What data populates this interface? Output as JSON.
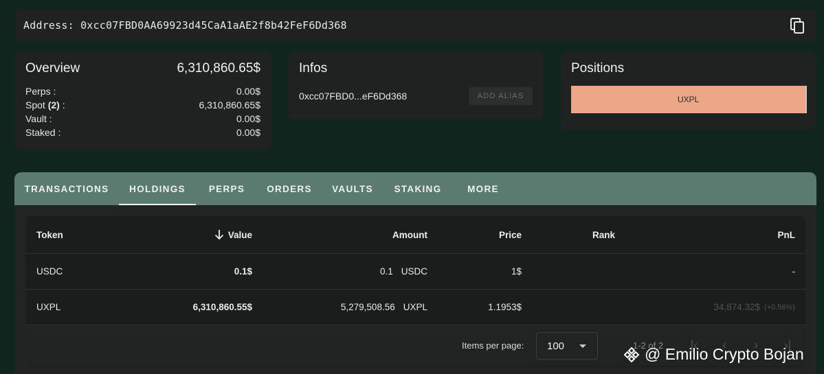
{
  "address_bar": {
    "label": "Address: 0xcc07FBD0AA69923d45CaA1aAE2f8b42FeF6Dd368"
  },
  "overview": {
    "title": "Overview",
    "total": "6,310,860.65$",
    "rows": [
      {
        "label": "Perps :",
        "value": "0.00$"
      },
      {
        "label_pre": "Spot ",
        "label_bold": "(2)",
        "label_post": " :",
        "value": "6,310,860.65$"
      },
      {
        "label": "Vault :",
        "value": "0.00$"
      },
      {
        "label": "Staked :",
        "value": "0.00$"
      }
    ]
  },
  "infos": {
    "title": "Infos",
    "short_address": "0xcc07FBD0...eF6Dd368",
    "add_alias_label": "ADD ALIAS"
  },
  "positions": {
    "title": "Positions",
    "items": [
      {
        "label": "UXPL",
        "color": "#eea688"
      }
    ]
  },
  "tabs": [
    "TRANSACTIONS",
    "HOLDINGS",
    "PERPS",
    "ORDERS",
    "VAULTS",
    "STAKING",
    "MORE"
  ],
  "active_tab": "HOLDINGS",
  "table": {
    "headers": {
      "token": "Token",
      "value": "Value",
      "amount": "Amount",
      "price": "Price",
      "rank": "Rank",
      "pnl": "PnL"
    },
    "sort_icon": "arrow-down-icon",
    "rows": [
      {
        "token": "USDC",
        "value": "0.1$",
        "amount": "0.1",
        "amount_unit": "USDC",
        "price": "1$",
        "rank": "",
        "pnl": "-",
        "pnl_pct": ""
      },
      {
        "token": "UXPL",
        "value": "6,310,860.55$",
        "amount": "5,279,508.56",
        "amount_unit": "UXPL",
        "price": "1.1953$",
        "rank": "",
        "pnl": "34,874.32$",
        "pnl_pct": "(+0.56%)"
      }
    ]
  },
  "pagination": {
    "items_per_page_label": "Items per page:",
    "items_per_page": "100",
    "range": "1-2 of 2"
  },
  "watermark": {
    "text": "@ Emilio Crypto Bojan"
  }
}
